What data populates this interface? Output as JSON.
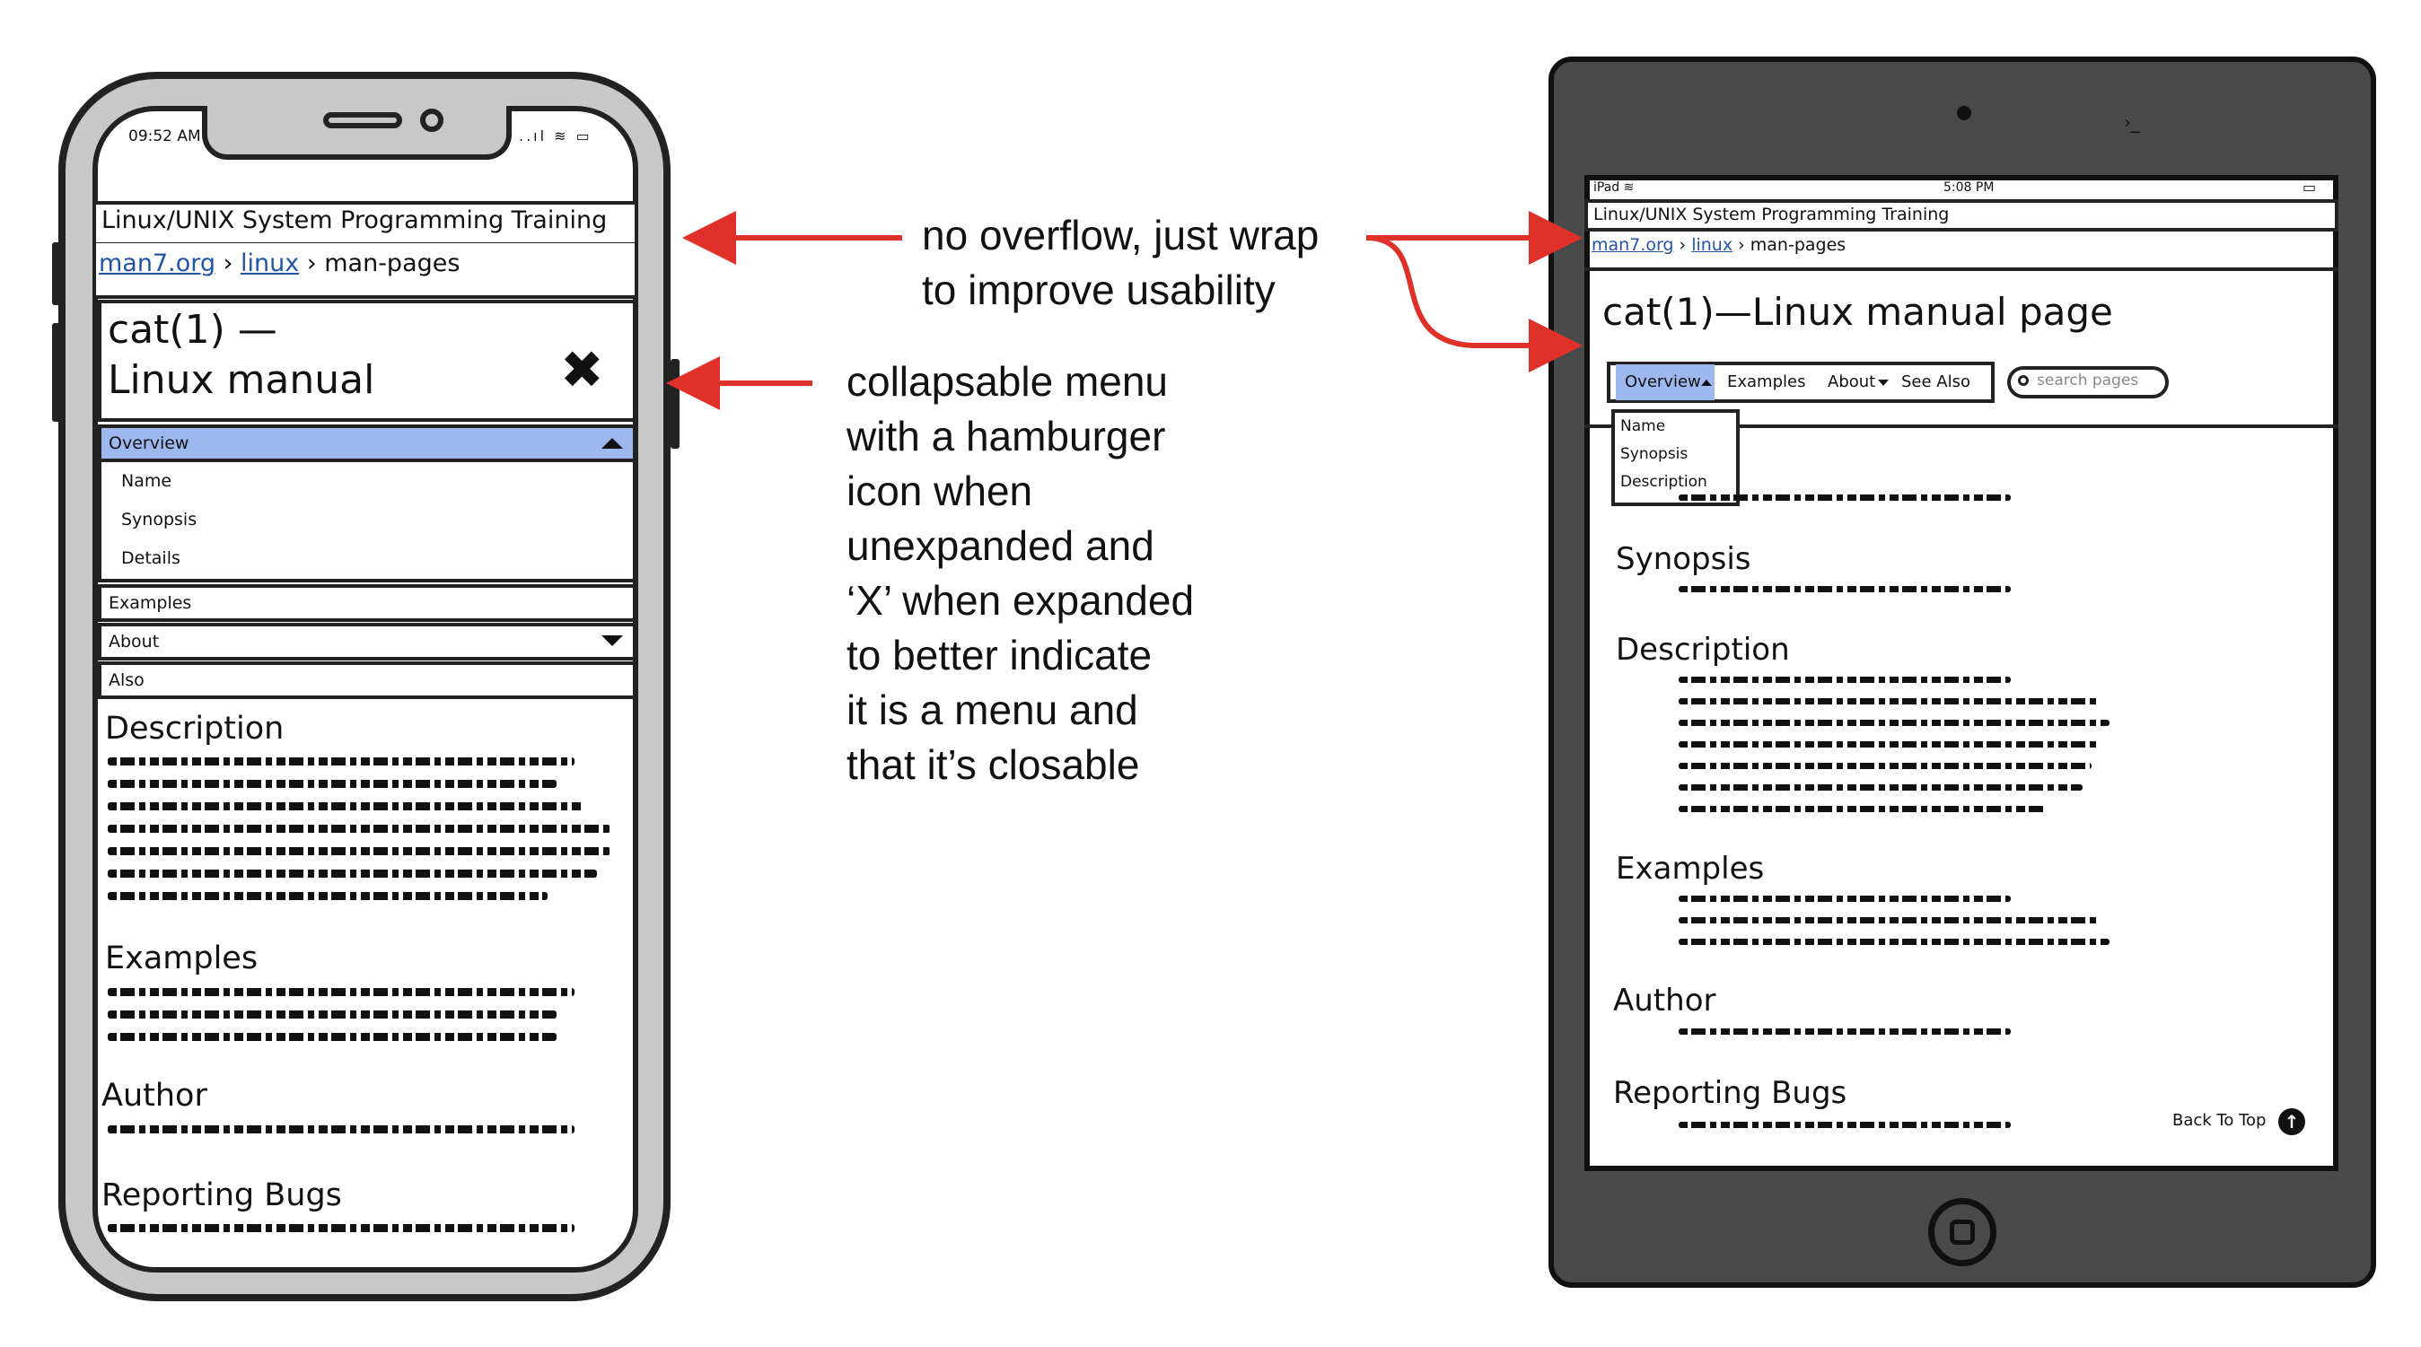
{
  "phone": {
    "status_time": "09:52 AM",
    "status_icons": "..ıl ≋ ▭",
    "site_title": "Linux/UNIX System Programming Training",
    "breadcrumb": {
      "root": "man7.org",
      "sep1": "›",
      "section": "linux",
      "sep2": "›",
      "current": "man-pages"
    },
    "page_title_line1": "cat(1) —",
    "page_title_line2": "Linux manual",
    "close_glyph": "✖",
    "menu": {
      "overview": "Overview",
      "overview_items": [
        "Name",
        "Synopsis",
        "Details"
      ],
      "examples": "Examples",
      "about": "About",
      "also": "Also"
    },
    "sections": [
      "Description",
      "Examples",
      "Author",
      "Reporting Bugs"
    ]
  },
  "tablet": {
    "status_left": "iPad ≋",
    "status_time": "5:08 PM",
    "status_battery": "▭",
    "site_title": "Linux/UNIX System Programming Training",
    "breadcrumb": {
      "root": "man7.org",
      "sep1": "›",
      "section": "linux",
      "sep2": "›",
      "current": "man-pages"
    },
    "page_title": "cat(1)—Linux manual page",
    "nav": {
      "overview": "Overview",
      "examples": "Examples",
      "about": "About",
      "see_also": "See Also"
    },
    "search_placeholder": "search pages",
    "dropdown_items": [
      "Name",
      "Synopsis",
      "Description"
    ],
    "sections": [
      "Synopsis",
      "Description",
      "Examples",
      "Author",
      "Reporting Bugs"
    ],
    "back_to_top": "Back To Top",
    "corner_mark": "›_"
  },
  "annotations": {
    "wrap_note": [
      "no overflow, just wrap",
      "to improve usability"
    ],
    "menu_note": [
      "collapsable menu",
      "with a hamburger",
      "icon when",
      "unexpanded and",
      "‘X’ when expanded",
      "to better indicate",
      "it is a menu and",
      "that it’s closable"
    ],
    "arrow_color": "#e0302a"
  }
}
